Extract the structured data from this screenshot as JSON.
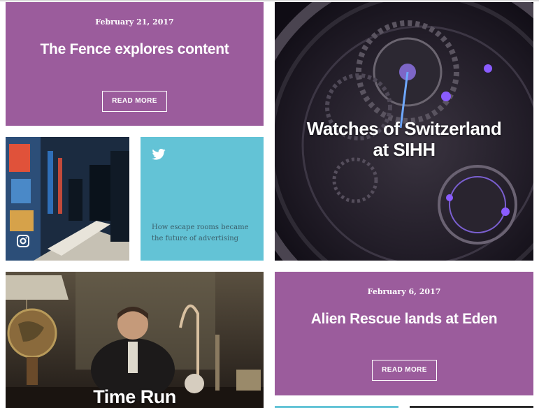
{
  "cards": {
    "fence": {
      "date": "February 21, 2017",
      "title": "The Fence explores content",
      "button": "READ MORE"
    },
    "watches": {
      "title_line1": "Watches of Switzerland",
      "title_line2": "at SIHH"
    },
    "escape": {
      "text": "How escape rooms became the future of advertising",
      "icon": "twitter-bird-icon"
    },
    "instagram": {
      "icon": "instagram-icon"
    },
    "alien": {
      "date": "February 6, 2017",
      "title": "Alien Rescue lands at Eden",
      "button": "READ MORE"
    },
    "timerun": {
      "title": "Time Run"
    }
  },
  "colors": {
    "purple": "#9b5c9c",
    "cyan": "#63c3d6"
  }
}
